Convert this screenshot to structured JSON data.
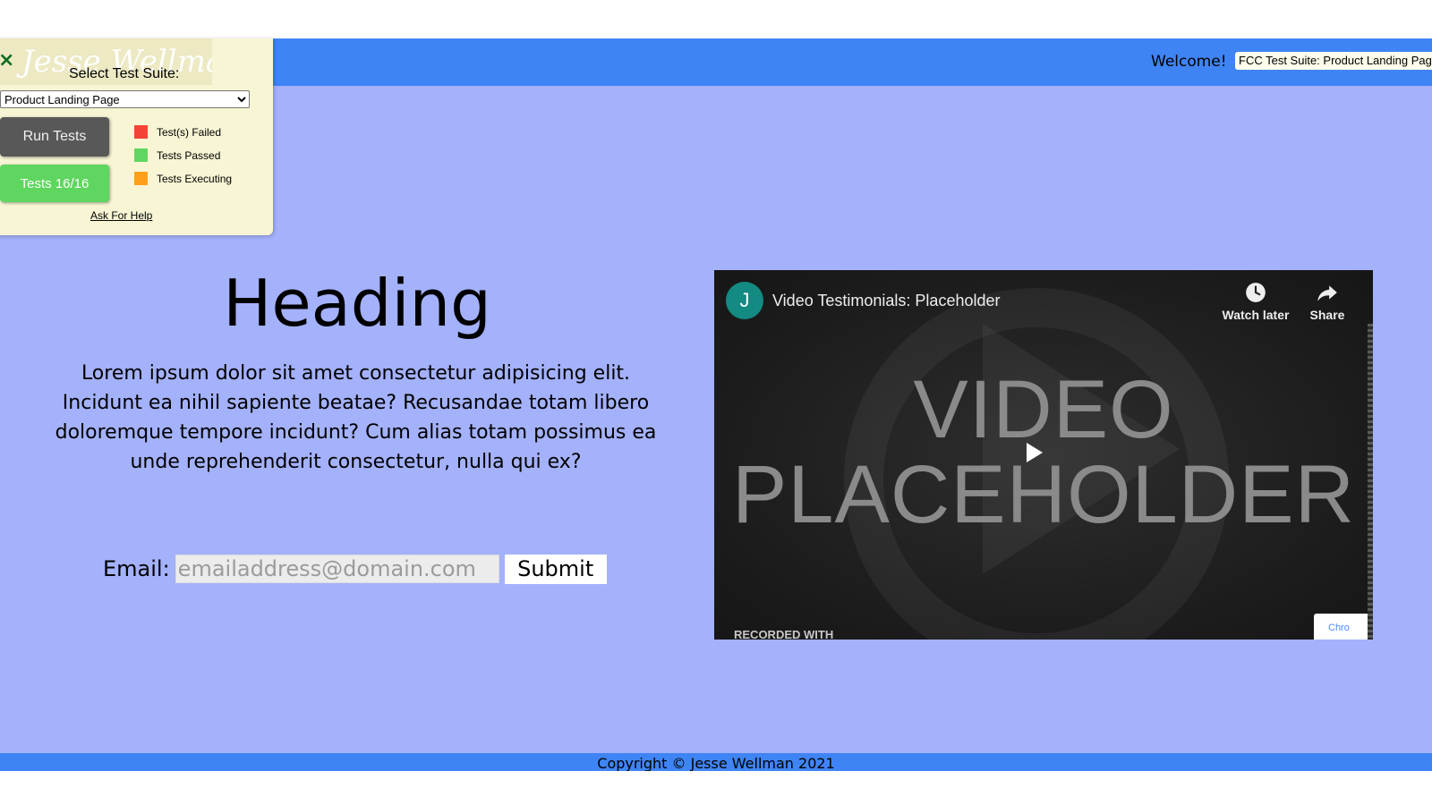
{
  "header": {
    "welcome": "Welcome!",
    "suite_name": "FCC Test Suite: Product Landing Page"
  },
  "main": {
    "heading": "Heading",
    "paragraph": "Lorem ipsum dolor sit amet consectetur adipisicing elit. Incidunt ea nihil sapiente beatae? Recusandae totam libero doloremque tempore incidunt? Cum alias totam possimus ea unde reprehenderit consectetur, nulla qui ex?",
    "email_label": "Email:",
    "email_placeholder": "emailaddress@domain.com",
    "email_value": "",
    "submit_label": "Submit"
  },
  "video": {
    "avatar_letter": "J",
    "title": "Video Testimonials: Placeholder",
    "watch_later": "Watch later",
    "share": "Share",
    "line1": "VIDEO",
    "line2": "PLACEHOLDER",
    "recorded": "RECORDED WITH",
    "badge": "Chro"
  },
  "footer": {
    "copyright": "Copyright © Jesse Wellman 2021"
  },
  "fcc_panel": {
    "logo_text": "Jesse Wellman",
    "close_glyph": "×",
    "select_label": "Select Test Suite:",
    "selected_suite": "Product Landing Page",
    "run_label": "Run Tests",
    "tests_label": "Tests 16/16",
    "legend": [
      {
        "label": "Test(s) Failed",
        "color": "#f44336"
      },
      {
        "label": "Tests Passed",
        "color": "#5fd65f"
      },
      {
        "label": "Tests Executing",
        "color": "#ff9f1a"
      }
    ],
    "help_label": "Ask For Help"
  },
  "colors": {
    "header_blue": "#3f84f4",
    "main_bg": "#a4b1fb",
    "panel_bg": "#f7f5d4"
  }
}
